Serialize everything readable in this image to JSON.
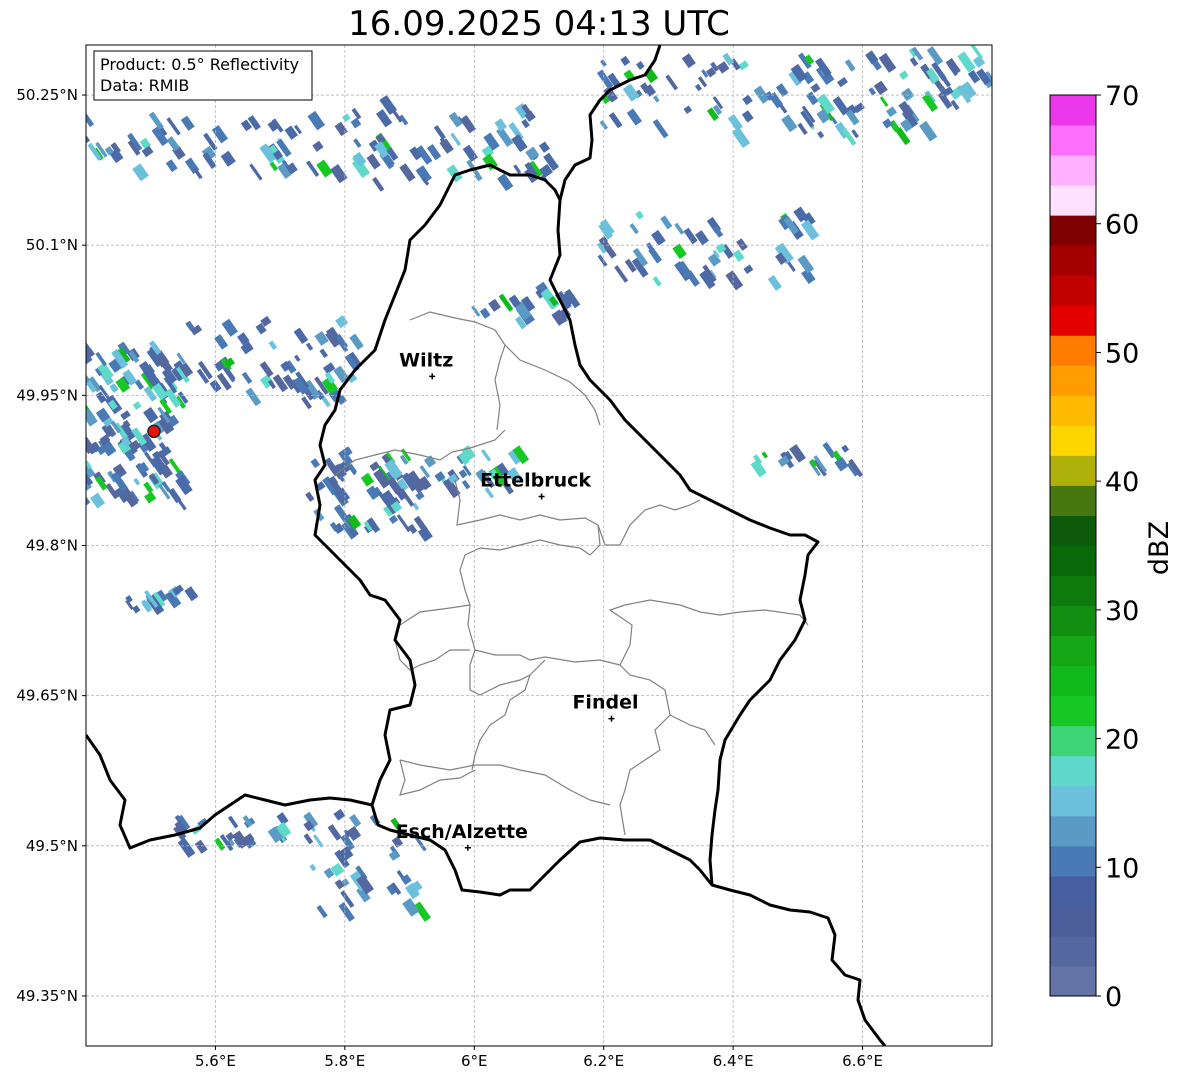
{
  "title": "16.09.2025 04:13 UTC",
  "info": {
    "product": "Product: 0.5° Reflectivity",
    "data": "Data: RMIB"
  },
  "axes": {
    "lon_min": 5.4,
    "lon_max": 6.8,
    "lat_min": 49.3,
    "lat_max": 50.3,
    "x_ticks": [
      {
        "value": 5.6,
        "label": "5.6°E"
      },
      {
        "value": 5.8,
        "label": "5.8°E"
      },
      {
        "value": 6.0,
        "label": "6°E"
      },
      {
        "value": 6.2,
        "label": "6.2°E"
      },
      {
        "value": 6.4,
        "label": "6.4°E"
      },
      {
        "value": 6.6,
        "label": "6.6°E"
      }
    ],
    "y_ticks": [
      {
        "value": 50.25,
        "label": "50.25°N"
      },
      {
        "value": 50.1,
        "label": "50.1°N"
      },
      {
        "value": 49.95,
        "label": "49.95°N"
      },
      {
        "value": 49.8,
        "label": "49.8°N"
      },
      {
        "value": 49.65,
        "label": "49.65°N"
      },
      {
        "value": 49.5,
        "label": "49.5°N"
      },
      {
        "value": 49.35,
        "label": "49.35°N"
      }
    ],
    "grid": true
  },
  "cities": [
    {
      "name": "Wiltz",
      "lon": 5.935,
      "lat": 49.969
    },
    {
      "name": "Ettelbruck",
      "lon": 6.104,
      "lat": 49.849
    },
    {
      "name": "Findel",
      "lon": 6.212,
      "lat": 49.627
    },
    {
      "name": "Esch/Alzette",
      "lon": 5.99,
      "lat": 49.498
    }
  ],
  "radar_site": {
    "lon": 5.505,
    "lat": 49.914,
    "color": "#e8140c"
  },
  "colorbar": {
    "label": "dBZ",
    "min": 0,
    "max": 70,
    "tick_values": [
      0,
      10,
      20,
      30,
      40,
      50,
      60,
      70
    ],
    "colors": [
      "#6373a6",
      "#55679f",
      "#4b5d9a",
      "#455fa0",
      "#4a7ab5",
      "#5a9ac4",
      "#6bc1dc",
      "#5fd9c9",
      "#3ed578",
      "#17c723",
      "#12b91b",
      "#15a716",
      "#128f12",
      "#0d7a0e",
      "#0a6a0a",
      "#0c5a0a",
      "#487711",
      "#b0b00c",
      "#fdd500",
      "#ffba00",
      "#ff9c00",
      "#ff7c00",
      "#e50000",
      "#c10000",
      "#a50000",
      "#7e0000",
      "#ffe0ff",
      "#ffb1ff",
      "#ff6fff",
      "#ea37ea"
    ]
  },
  "colors": {
    "border": "#000000",
    "canton": "#808080",
    "grid": "#b4b4b4"
  }
}
